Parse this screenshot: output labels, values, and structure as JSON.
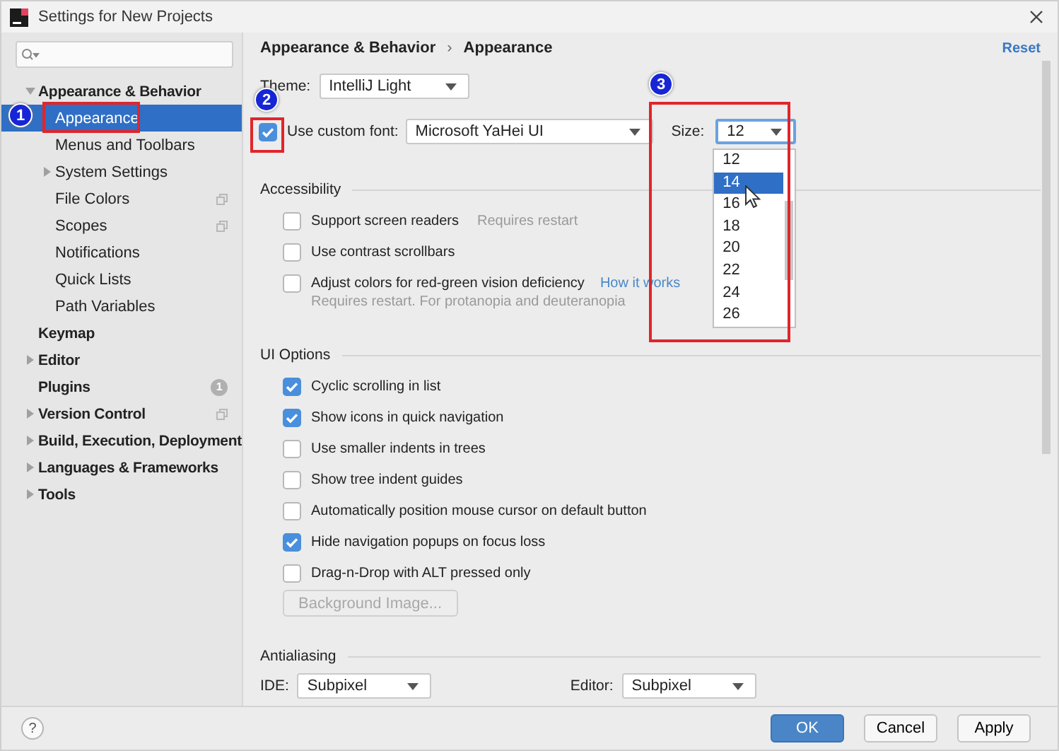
{
  "window": {
    "title": "Settings for New Projects"
  },
  "sidebar": {
    "items": [
      {
        "label": "Appearance & Behavior",
        "expanded": true,
        "selected": false,
        "project_icon": false,
        "children": [
          {
            "label": "Appearance",
            "selected": true,
            "project_icon": false
          },
          {
            "label": "Menus and Toolbars",
            "selected": false,
            "project_icon": false
          },
          {
            "label": "System Settings",
            "expanded": false,
            "selected": false,
            "project_icon": false
          },
          {
            "label": "File Colors",
            "selected": false,
            "project_icon": true
          },
          {
            "label": "Scopes",
            "selected": false,
            "project_icon": true
          },
          {
            "label": "Notifications",
            "selected": false,
            "project_icon": false
          },
          {
            "label": "Quick Lists",
            "selected": false,
            "project_icon": false
          },
          {
            "label": "Path Variables",
            "selected": false,
            "project_icon": false
          }
        ]
      },
      {
        "label": "Keymap",
        "selected": false,
        "project_icon": false
      },
      {
        "label": "Editor",
        "expanded": false,
        "selected": false,
        "project_icon": false
      },
      {
        "label": "Plugins",
        "selected": false,
        "project_icon": false,
        "badge": "1"
      },
      {
        "label": "Version Control",
        "expanded": false,
        "selected": false,
        "project_icon": true
      },
      {
        "label": "Build, Execution, Deployment",
        "expanded": false,
        "selected": false,
        "project_icon": false
      },
      {
        "label": "Languages & Frameworks",
        "expanded": false,
        "selected": false,
        "project_icon": false
      },
      {
        "label": "Tools",
        "expanded": false,
        "selected": false,
        "project_icon": false
      }
    ]
  },
  "breadcrumb": {
    "items": [
      "Appearance & Behavior",
      "Appearance"
    ],
    "separator": "›"
  },
  "reset_link": "Reset",
  "theme": {
    "label": "Theme:",
    "value": "IntelliJ Light"
  },
  "custom_font": {
    "label": "Use custom font:",
    "checked": true,
    "font": "Microsoft YaHei UI",
    "size_label": "Size:",
    "size": "12",
    "size_options": [
      {
        "label": "12",
        "selected": false
      },
      {
        "label": "14",
        "selected": true
      },
      {
        "label": "16",
        "selected": false
      },
      {
        "label": "18",
        "selected": false
      },
      {
        "label": "20",
        "selected": false
      },
      {
        "label": "22",
        "selected": false
      },
      {
        "label": "24",
        "selected": false
      },
      {
        "label": "26",
        "selected": false
      }
    ]
  },
  "sections": [
    {
      "title": "Accessibility",
      "options": [
        {
          "label": "Support screen readers",
          "checked": false,
          "note": "Requires restart"
        },
        {
          "label": "Use contrast scrollbars",
          "checked": false
        },
        {
          "label": "Adjust colors for red-green vision deficiency",
          "checked": false,
          "link": "How it works",
          "hint": "Requires restart. For protanopia and deuteranopia"
        }
      ]
    },
    {
      "title": "UI Options",
      "options": [
        {
          "label": "Cyclic scrolling in list",
          "checked": true
        },
        {
          "label": "Show icons in quick navigation",
          "checked": true
        },
        {
          "label": "Use smaller indents in trees",
          "checked": false
        },
        {
          "label": "Show tree indent guides",
          "checked": false
        },
        {
          "label": "Automatically position mouse cursor on default button",
          "checked": false
        },
        {
          "label": "Hide navigation popups on focus loss",
          "checked": true
        },
        {
          "label": "Drag-n-Drop with ALT pressed only",
          "checked": false
        }
      ],
      "button": {
        "label": "Background Image...",
        "disabled": true
      }
    },
    {
      "title": "Antialiasing",
      "fields": [
        {
          "label": "IDE:",
          "value": "Subpixel"
        },
        {
          "label": "Editor:",
          "value": "Subpixel"
        }
      ]
    }
  ],
  "footer": {
    "help": "?",
    "buttons": [
      {
        "label": "OK",
        "default": true
      },
      {
        "label": "Cancel",
        "default": false
      },
      {
        "label": "Apply",
        "default": false
      }
    ]
  },
  "annotations": [
    {
      "number": "1"
    },
    {
      "number": "2"
    },
    {
      "number": "3"
    }
  ]
}
